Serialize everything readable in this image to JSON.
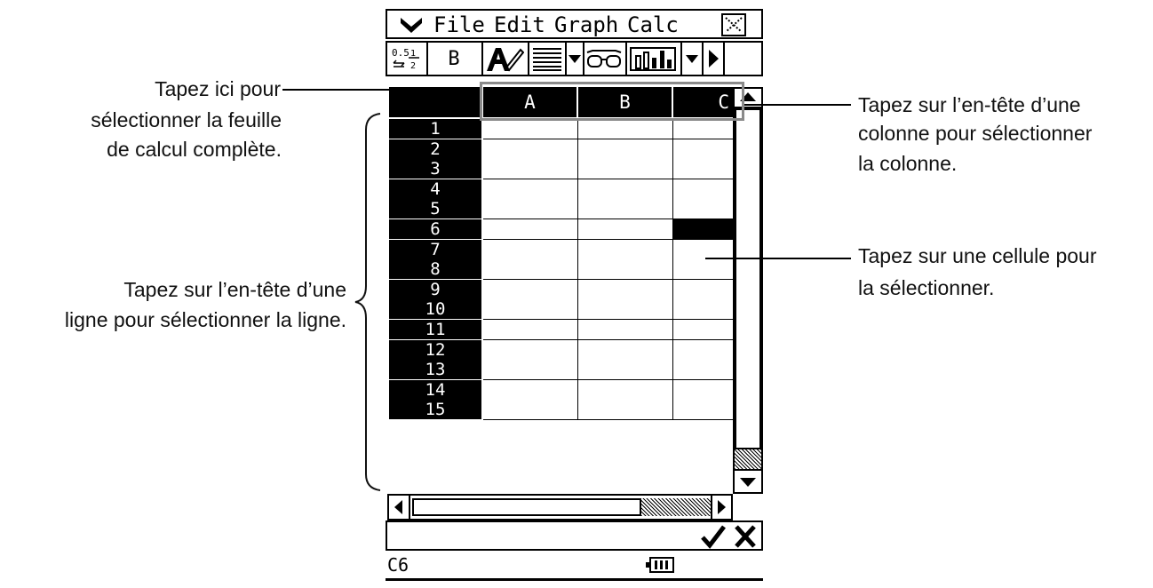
{
  "menubar": {
    "menu_icon": "menu-down-icon",
    "items": [
      "File",
      "Edit",
      "Graph",
      "Calc"
    ],
    "close_icon": "close-x-icon"
  },
  "toolbar": {
    "fraction_toggle_label": "0.5 ↔ ½",
    "bold_label": "B",
    "icons": [
      "fraction-decimal-icon",
      "bold-icon",
      "text-style-icon",
      "align-icon",
      "dropdown-icon",
      "view-glasses-icon",
      "bar-chart-icon",
      "dropdown-icon",
      "play-right-icon"
    ]
  },
  "sheet": {
    "columns": [
      "A",
      "B",
      "C"
    ],
    "rows": [
      "1",
      "2",
      "3",
      "4",
      "5",
      "6",
      "7",
      "8",
      "9",
      "10",
      "11",
      "12",
      "13",
      "14",
      "15"
    ],
    "selected_cell": {
      "column": "C",
      "row": "6"
    }
  },
  "editline": {
    "value": "",
    "confirm_icon": "check-icon",
    "cancel_icon": "cancel-x-icon"
  },
  "status": {
    "cell_ref": "C6",
    "battery_icon": "battery-icon"
  },
  "annotations": {
    "corner": [
      "Tapez ici pour",
      "sélectionner la feuille",
      "de calcul complète."
    ],
    "column": [
      "Tapez sur l’en-tête d’une",
      "colonne pour sélectionner",
      "la colonne."
    ],
    "cell": [
      "Tapez sur une cellule pour",
      "la sélectionner."
    ],
    "row": [
      "Tapez sur l’en-tête d’une",
      "ligne pour sélectionner la ligne."
    ]
  }
}
